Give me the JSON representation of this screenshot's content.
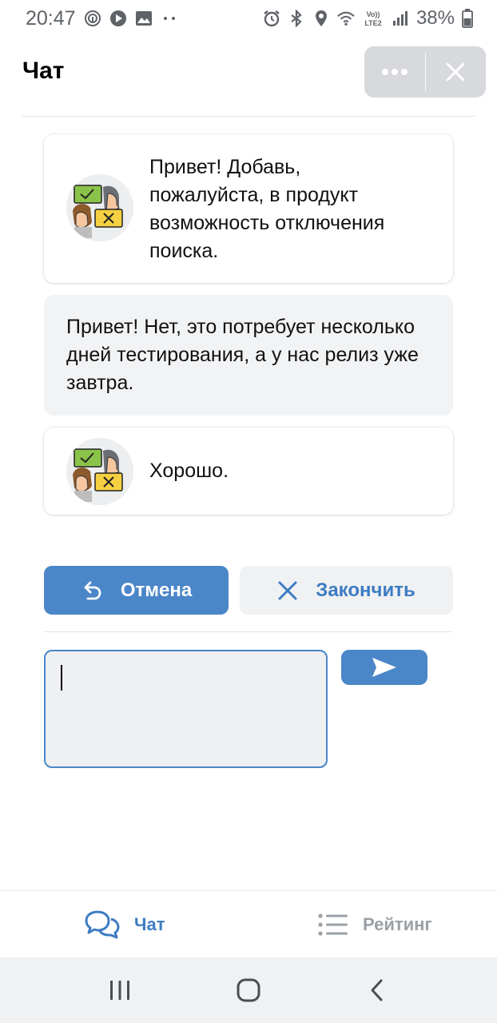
{
  "status_bar": {
    "time": "20:47",
    "battery": "38%",
    "icons": [
      "fingerprint-icon",
      "play-icon",
      "image-icon",
      "dots-icon",
      "alarm-icon",
      "bluetooth-icon",
      "location-icon",
      "wifi-icon",
      "volte-icon",
      "signal-icon",
      "battery-icon"
    ],
    "network_label": "Vo))\nLTE2"
  },
  "header": {
    "title": "Чат",
    "more_icon": "more-dots-icon",
    "close_icon": "close-icon"
  },
  "messages": [
    {
      "sender": "user",
      "has_avatar": true,
      "text": "Привет! Добавь, пожалуйста, в продукт возможность отключения поиска."
    },
    {
      "sender": "agent",
      "has_avatar": false,
      "text": "Привет! Нет, это потребует несколько дней тестирования, а у нас релиз уже завтра."
    },
    {
      "sender": "user",
      "has_avatar": true,
      "text": "Хорошо."
    }
  ],
  "actions": {
    "cancel_label": "Отмена",
    "cancel_icon": "undo-icon",
    "finish_label": "Закончить",
    "finish_icon": "close-icon"
  },
  "composer": {
    "value": "",
    "send_icon": "send-icon"
  },
  "tabs": [
    {
      "label": "Чат",
      "icon": "chat-bubbles-icon",
      "active": true
    },
    {
      "label": "Рейтинг",
      "icon": "list-icon",
      "active": false
    }
  ],
  "colors": {
    "accent": "#4a86c8",
    "accent_text": "#3d7cc3",
    "bubble_gray": "#f2f3f5",
    "pill_gray": "#d7d9dc"
  }
}
